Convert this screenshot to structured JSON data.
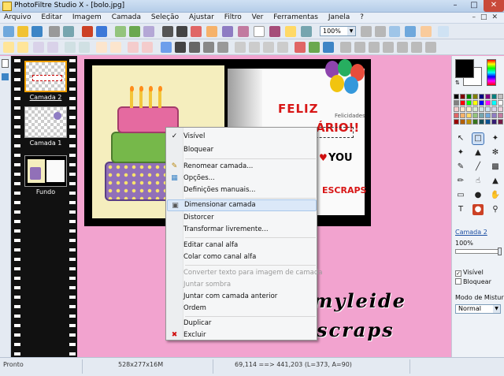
{
  "window": {
    "title": "PhotoFiltre Studio X - [bolo.jpg]"
  },
  "menubar": {
    "items": [
      "Arquivo",
      "Editar",
      "Imagem",
      "Camada",
      "Seleção",
      "Ajustar",
      "Filtro",
      "Ver",
      "Ferramentas",
      "Janela",
      "?"
    ]
  },
  "toolbar": {
    "zoom_value": "100%"
  },
  "layers_panel": {
    "layers": [
      {
        "name": "Camada 2",
        "selected": true
      },
      {
        "name": "Camada 1",
        "selected": false
      },
      {
        "name": "Fundo",
        "selected": false
      }
    ]
  },
  "canvas": {
    "card_text": {
      "feliz": "FELIZ",
      "ario": "ÁRIO!!",
      "felicidades": "Felicidades",
      "you": "YOU",
      "scraps": "ESCRAPS"
    },
    "watermark": {
      "line1": "myleide",
      "line2": "scraps"
    }
  },
  "context_menu": {
    "items": [
      {
        "label": "Visível",
        "enabled": true,
        "icon": "checkmark",
        "highlighted": false
      },
      {
        "label": "Bloquear",
        "enabled": true,
        "icon": "",
        "highlighted": false
      },
      {
        "label": "Renomear camada...",
        "enabled": true,
        "icon": "rename-icon",
        "highlighted": false
      },
      {
        "label": "Opções...",
        "enabled": true,
        "icon": "options-icon",
        "highlighted": false
      },
      {
        "label": "Definições manuais...",
        "enabled": true,
        "icon": "",
        "highlighted": false
      },
      {
        "label": "Dimensionar camada",
        "enabled": true,
        "icon": "resize-icon",
        "highlighted": true
      },
      {
        "label": "Distorcer",
        "enabled": true,
        "icon": "",
        "highlighted": false
      },
      {
        "label": "Transformar livremente...",
        "enabled": true,
        "icon": "",
        "highlighted": false
      },
      {
        "label": "Editar canal alfa",
        "enabled": true,
        "icon": "",
        "highlighted": false
      },
      {
        "label": "Colar como canal alfa",
        "enabled": true,
        "icon": "",
        "highlighted": false
      },
      {
        "label": "Converter texto para imagem de camada",
        "enabled": false,
        "icon": "",
        "highlighted": false
      },
      {
        "label": "Juntar sombra",
        "enabled": false,
        "icon": "",
        "highlighted": false
      },
      {
        "label": "Juntar com camada anterior",
        "enabled": true,
        "icon": "",
        "highlighted": false
      },
      {
        "label": "Ordem",
        "enabled": true,
        "icon": "",
        "highlighted": false
      },
      {
        "label": "Duplicar",
        "enabled": true,
        "icon": "",
        "highlighted": false
      },
      {
        "label": "Excluir",
        "enabled": true,
        "icon": "delete-x-icon",
        "highlighted": false
      }
    ]
  },
  "right_panel": {
    "layer_name": "Camada 2",
    "opacity": "100%",
    "visible_label": "Visível",
    "visible_checked": true,
    "lock_label": "Bloquear",
    "lock_checked": false,
    "blend_mode_label": "Modo de Mistur",
    "blend_mode_value": "Normal"
  },
  "statusbar": {
    "state": "Pronto",
    "image_size": "528x277x16M",
    "coords": "69,114 ==> 441,203 (L=373, A=90)"
  },
  "colors": {
    "workspace": "#f2a3cf",
    "menu_highlight": "#dbe8f8",
    "selected_layer_border": "#f0a000"
  }
}
